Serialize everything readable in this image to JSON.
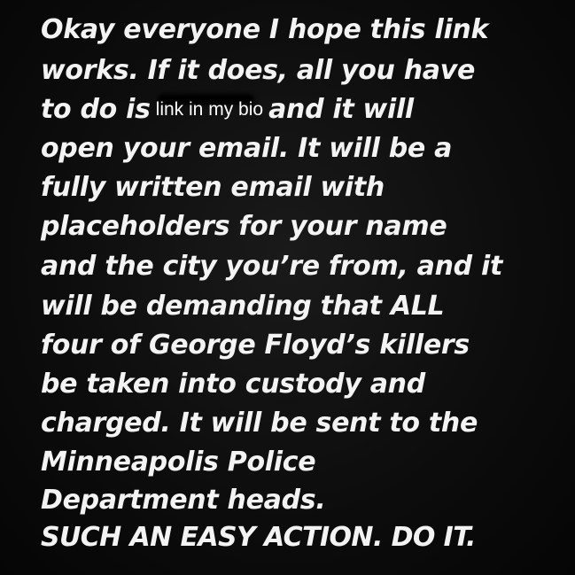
{
  "story": {
    "lines": [
      "Okay everyone I hope this link",
      "works. If it does, all you have",
      "to do is",
      "and it will",
      "open your email. It will be a",
      "fully written email with",
      "placeholders for your name",
      "and the city you’re from, and it",
      "will be demanding that ALL",
      "four of George Floyd’s killers",
      "be taken into custody and",
      "charged. It will be sent to the",
      "Minneapolis Police",
      "Department heads.",
      "SUCH AN EASY ACTION. DO IT."
    ],
    "link_sticker": "link in my bio"
  },
  "colors": {
    "background": "#0d0d0d",
    "text": "#f3f3f3"
  }
}
